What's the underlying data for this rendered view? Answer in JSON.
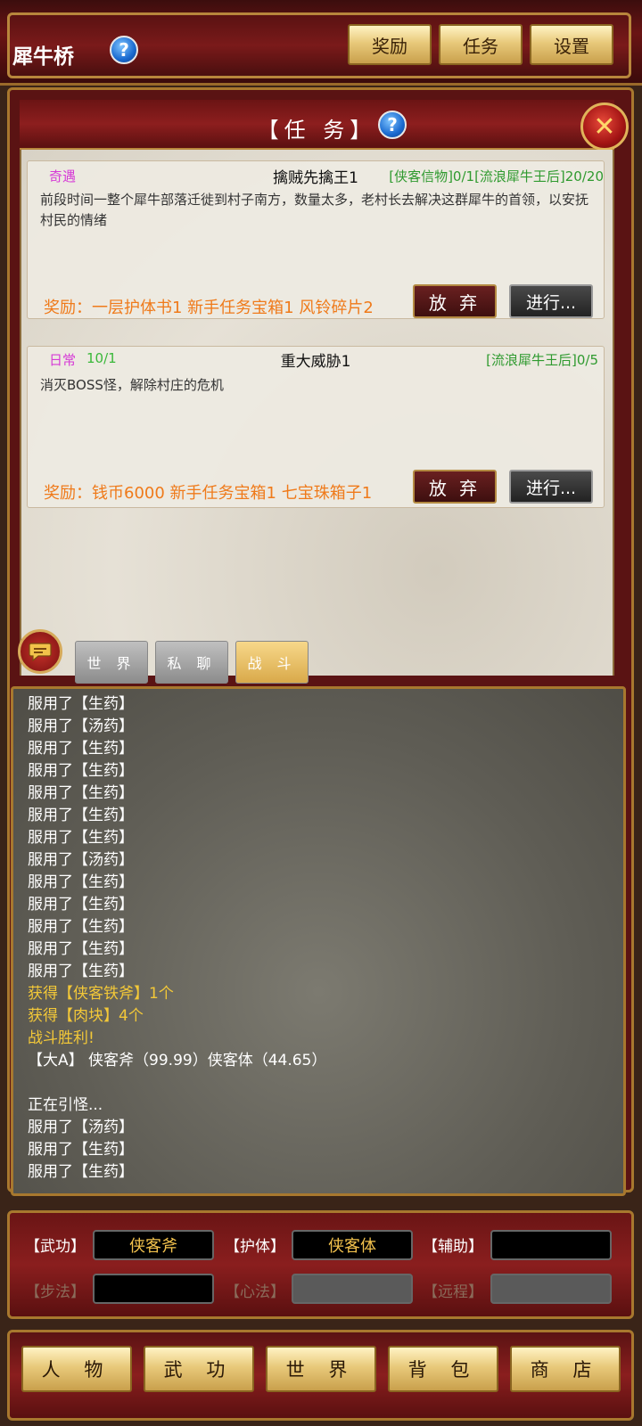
{
  "header": {
    "location": "犀牛桥",
    "help_icon": "?",
    "buttons": [
      "奖励",
      "任务",
      "设置"
    ]
  },
  "panel": {
    "title": "【任 务】",
    "help_icon": "?",
    "close_icon": "✕"
  },
  "quests": [
    {
      "type": "奇遇",
      "type_color": "#d63ad6",
      "count": "",
      "name": "擒贼先擒王1",
      "progress": "[侠客信物]0/1[流浪犀牛王后]20/20",
      "description": "前段时间一整个犀牛部落迁徙到村子南方，数量太多，老村长去解决这群犀牛的首领，以安抚村民的情绪",
      "reward": "奖励：一层护体书1 新手任务宝箱1 风铃碎片2",
      "abandon_label": "放 弃",
      "go_label": "进行..."
    },
    {
      "type": "日常",
      "type_color": "#d63ad6",
      "count": "10/1",
      "name": "重大威胁1",
      "progress": "[流浪犀牛王后]0/5",
      "description": "消灭BOSS怪，解除村庄的危机",
      "reward": "奖励：钱币6000 新手任务宝箱1 七宝珠箱子1",
      "abandon_label": "放 弃",
      "go_label": "进行..."
    }
  ],
  "chat": {
    "chat_icon": "chat-bubble-icon",
    "tabs": [
      {
        "label": "世 界",
        "active": false
      },
      {
        "label": "私 聊",
        "active": false
      },
      {
        "label": "战 斗",
        "active": true
      }
    ]
  },
  "log": [
    {
      "text": "服用了【生药】",
      "color": "#ffffff"
    },
    {
      "text": "服用了【生药】",
      "color": "#ffffff"
    },
    {
      "text": "服用了【汤药】",
      "color": "#ffffff"
    },
    {
      "text": "服用了【生药】",
      "color": "#ffffff"
    },
    {
      "text": "服用了【生药】",
      "color": "#ffffff"
    },
    {
      "text": "服用了【生药】",
      "color": "#ffffff"
    },
    {
      "text": "服用了【生药】",
      "color": "#ffffff"
    },
    {
      "text": "服用了【生药】",
      "color": "#ffffff"
    },
    {
      "text": "服用了【汤药】",
      "color": "#ffffff"
    },
    {
      "text": "服用了【生药】",
      "color": "#ffffff"
    },
    {
      "text": "服用了【生药】",
      "color": "#ffffff"
    },
    {
      "text": "服用了【生药】",
      "color": "#ffffff"
    },
    {
      "text": "服用了【生药】",
      "color": "#ffffff"
    },
    {
      "text": "服用了【生药】",
      "color": "#ffffff"
    },
    {
      "text": "获得【侠客铁斧】1个",
      "color": "#f3c838"
    },
    {
      "text": "获得【肉块】4个",
      "color": "#f3c838"
    },
    {
      "text": "战斗胜利!",
      "color": "#f3c838"
    },
    {
      "text": "【大A】 侠客斧（99.99）侠客体（44.65）",
      "color": "#ffffff"
    },
    {
      "text": " ",
      "color": "#ffffff"
    },
    {
      "text": "正在引怪...",
      "color": "#ffffff"
    },
    {
      "text": "服用了【汤药】",
      "color": "#ffffff"
    },
    {
      "text": "服用了【生药】",
      "color": "#ffffff"
    },
    {
      "text": "服用了【生药】",
      "color": "#ffffff"
    }
  ],
  "skills": {
    "row1": [
      {
        "label": "【武功】",
        "value": "侠客斧",
        "enabled": true
      },
      {
        "label": "【护体】",
        "value": "侠客体",
        "enabled": true
      },
      {
        "label": "【辅助】",
        "value": "",
        "enabled": true
      }
    ],
    "row2": [
      {
        "label": "【步法】",
        "value": "",
        "enabled": false
      },
      {
        "label": "【心法】",
        "value": "",
        "enabled": false
      },
      {
        "label": "【远程】",
        "value": "",
        "enabled": false
      }
    ]
  },
  "nav": [
    "人 物",
    "武 功",
    "世 界",
    "背 包",
    "商 店"
  ]
}
